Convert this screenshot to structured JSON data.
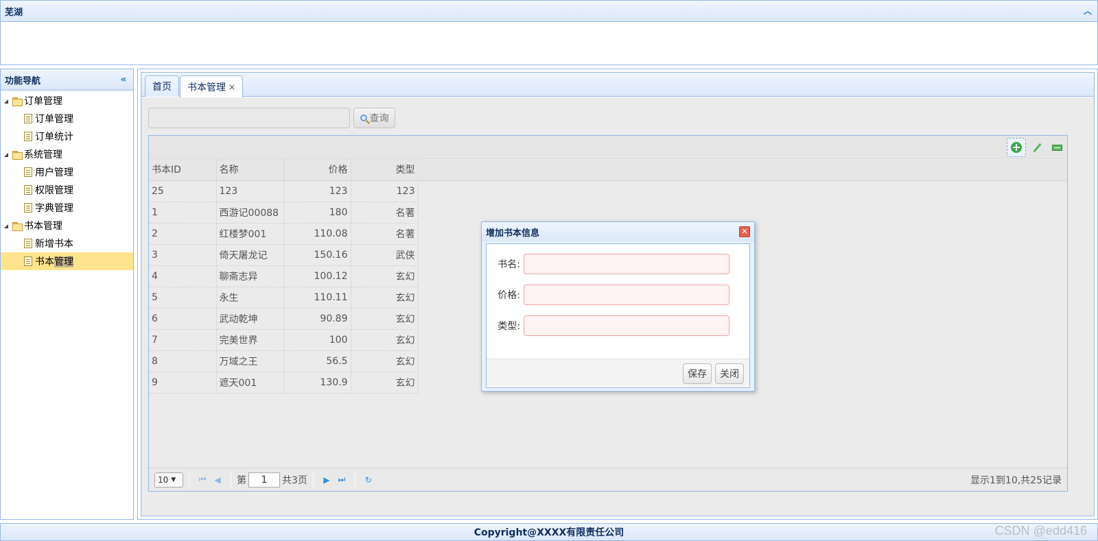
{
  "top": {
    "title": "芜湖"
  },
  "west": {
    "title": "功能导航",
    "tree": [
      {
        "label": "订单管理",
        "type": "folder"
      },
      {
        "label": "订单管理",
        "type": "file"
      },
      {
        "label": "订单统计",
        "type": "file"
      },
      {
        "label": "系统管理",
        "type": "folder"
      },
      {
        "label": "用户管理",
        "type": "file"
      },
      {
        "label": "权限管理",
        "type": "file"
      },
      {
        "label": "字典管理",
        "type": "file"
      },
      {
        "label": "书本管理",
        "type": "folder"
      },
      {
        "label": "新增书本",
        "type": "file"
      },
      {
        "label_a": "书本",
        "label_b": "管理",
        "type": "file",
        "selected": true
      }
    ]
  },
  "tabs": [
    {
      "label": "首页"
    },
    {
      "label": "书本管理",
      "close": "×",
      "active": true
    }
  ],
  "search": {
    "value": "",
    "button": "查询"
  },
  "grid": {
    "columns": [
      "书本ID",
      "名称",
      "价格",
      "类型"
    ],
    "rows": [
      [
        "25",
        "123",
        "123",
        "123"
      ],
      [
        "1",
        "西游记00088",
        "180",
        "名著"
      ],
      [
        "2",
        "红楼梦001",
        "110.08",
        "名著"
      ],
      [
        "3",
        "倚天屠龙记",
        "150.16",
        "武侠"
      ],
      [
        "4",
        "聊斋志异",
        "100.12",
        "玄幻"
      ],
      [
        "5",
        "永生",
        "110.11",
        "玄幻"
      ],
      [
        "6",
        "武动乾坤",
        "90.89",
        "玄幻"
      ],
      [
        "7",
        "完美世界",
        "100",
        "玄幻"
      ],
      [
        "8",
        "万域之王",
        "56.5",
        "玄幻"
      ],
      [
        "9",
        "遮天001",
        "130.9",
        "玄幻"
      ]
    ],
    "toolbar_icons": [
      "add-icon",
      "edit-icon",
      "remove-icon"
    ]
  },
  "pager": {
    "page_size": "10",
    "page_prefix": "第",
    "page_number": "1",
    "page_suffix": "共3页",
    "info": "显示1到10,共25记录"
  },
  "dialog": {
    "title": "增加书本信息",
    "fields": [
      {
        "label": "书名:",
        "value": ""
      },
      {
        "label": "价格:",
        "value": ""
      },
      {
        "label": "类型:",
        "value": ""
      }
    ],
    "save": "保存",
    "close": "关闭"
  },
  "footer": {
    "text": "Copyright@XXXX有限责任公司"
  },
  "watermark": "CSDN @edd416",
  "colors": {
    "border": "#95b8e7",
    "selected_row": "#ffe48d",
    "required_input": "#fff3f3"
  }
}
